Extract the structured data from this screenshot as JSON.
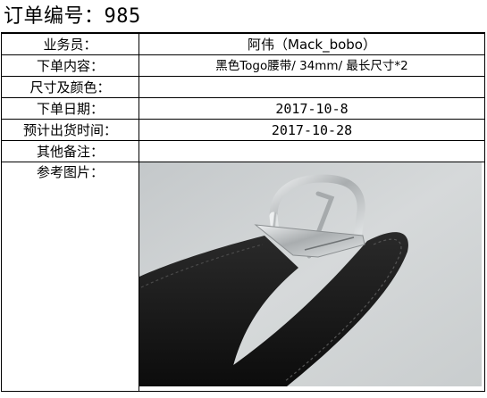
{
  "order": {
    "title_label": "订单编号：",
    "title_number": "985"
  },
  "fields": {
    "salesperson": {
      "label": "业务员：",
      "value": "阿伟（Mack_bobo）"
    },
    "order_content": {
      "label": "下单内容：",
      "value": "黑色Togo腰带/ 34mm/ 最长尺寸*2"
    },
    "size_color": {
      "label": "尺寸及颜色：",
      "value": ""
    },
    "order_date": {
      "label": "下单日期：",
      "value": "2017-10-8"
    },
    "ship_date": {
      "label": "预计出货时间：",
      "value": "2017-10-28"
    },
    "remarks": {
      "label": "其他备注：",
      "value": ""
    },
    "reference_image": {
      "label": "参考图片："
    }
  },
  "colors": {
    "background": "#cfd3d4",
    "belt": "#141414",
    "buckle": "#b9bcbd"
  }
}
